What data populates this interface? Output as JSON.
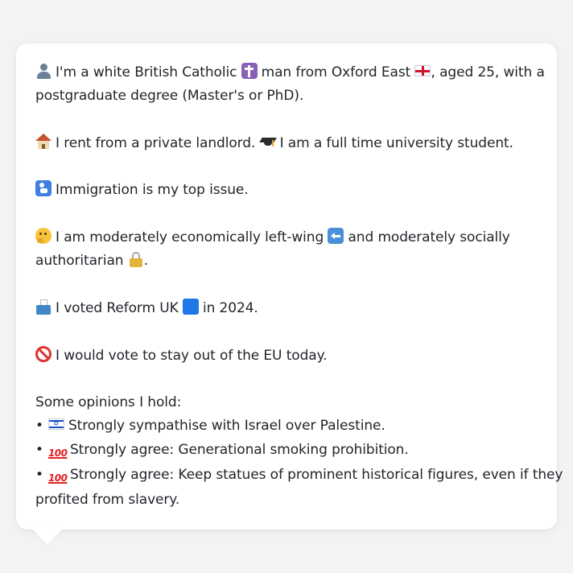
{
  "card": {
    "identity": {
      "part1": "I'm a white British Catholic",
      "part2": "man from Oxford East",
      "part3": ", aged 25, with a",
      "part4": "postgraduate degree (Master's or PhD)."
    },
    "housing": {
      "part1": "I rent from a private landlord.",
      "part2": "I am a full time university student."
    },
    "issue": {
      "text": "Immigration is my top issue."
    },
    "ideology": {
      "part1": "I am moderately economically left-wing",
      "part2": "and moderately socially",
      "part3": "authoritarian",
      "part4": "."
    },
    "vote": {
      "part1": "I voted Reform UK",
      "part2": "in 2024."
    },
    "eu": {
      "text": "I would vote to stay out of the EU today."
    },
    "opinions": {
      "heading": "Some opinions I hold:",
      "bullet": "•",
      "items": [
        {
          "text": "Strongly sympathise with Israel over Palestine.",
          "icon": "israel-flag-icon"
        },
        {
          "text": "Strongly agree: Generational smoking prohibition.",
          "icon": "hundred-points-icon"
        },
        {
          "text_line1": "Strongly agree: Keep statues of prominent historical figures, even if they",
          "text_line2": "profited from slavery.",
          "icon": "hundred-points-icon"
        }
      ],
      "hundred_glyph": "100"
    },
    "colors": {
      "card_background": "#ffffff",
      "page_background": "#f1f3f5",
      "text": "#1f2328"
    }
  }
}
